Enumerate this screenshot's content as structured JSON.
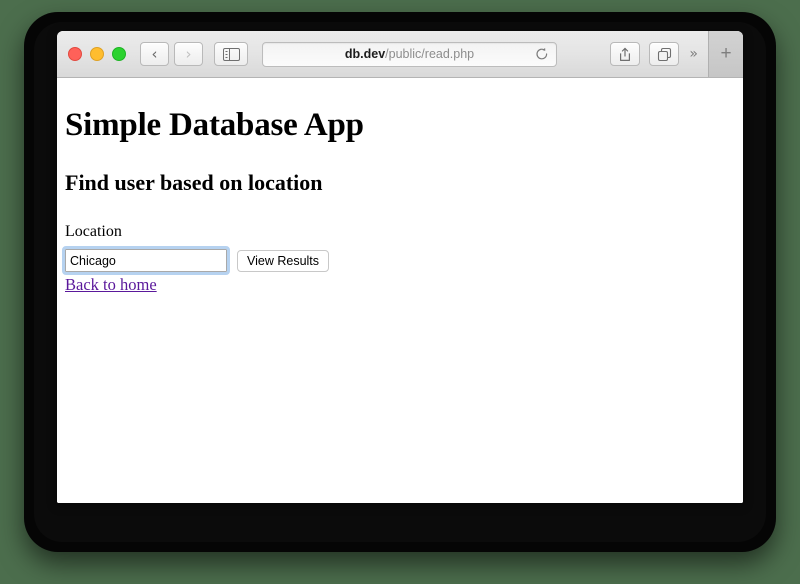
{
  "browser": {
    "traffic_lights": [
      {
        "name": "close",
        "color": "#ff6159"
      },
      {
        "name": "minimize",
        "color": "#ffbd2e"
      },
      {
        "name": "zoom",
        "color": "#2bd22f"
      }
    ],
    "back_glyph": "‹",
    "forward_glyph": "›",
    "sidebar_icon": "sidebar-icon",
    "url": {
      "host": "db.dev",
      "path": "/public/read.php"
    },
    "reload_icon": "reload-icon",
    "share_icon": "share-icon",
    "tabs_icon": "tabs-icon",
    "overflow_label": "»",
    "new_tab_label": "+"
  },
  "page": {
    "title": "Simple Database App",
    "subtitle": "Find user based on location",
    "form": {
      "location_label": "Location",
      "location_value": "Chicago",
      "location_placeholder": "",
      "submit_label": "View Results"
    },
    "back_link_label": "Back to home"
  },
  "colors": {
    "backdrop": "#4c6e4d",
    "frame": "#050505",
    "link": "#5a189b",
    "focus_ring": "#b6d2f0"
  }
}
